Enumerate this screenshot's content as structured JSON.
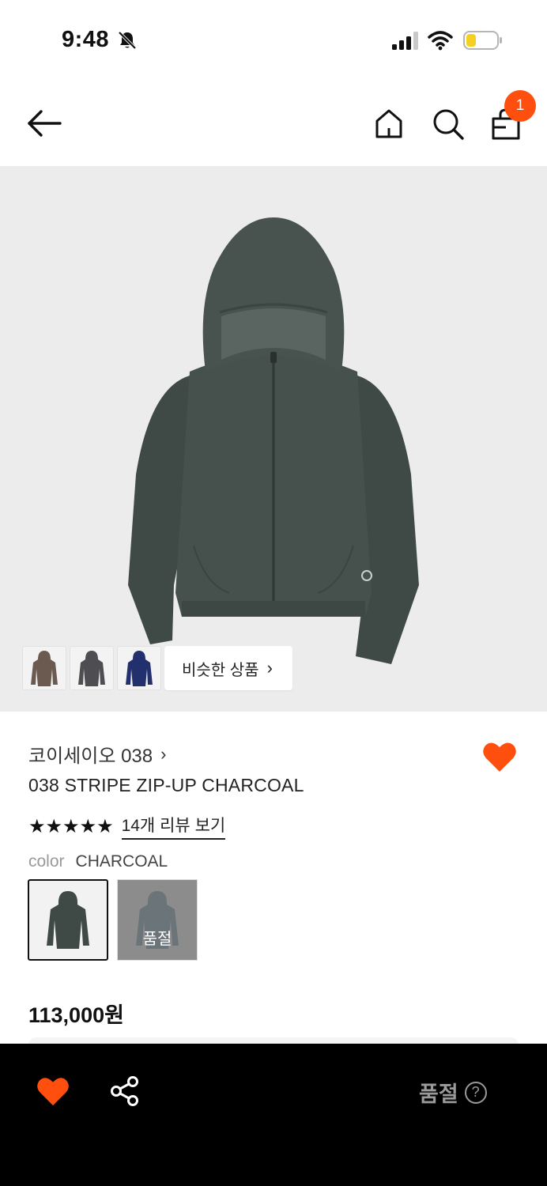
{
  "status_bar": {
    "time": "9:48"
  },
  "nav": {
    "cart_count": "1"
  },
  "gallery": {
    "similar_label": "비슷한 상품",
    "similar_chevron": "›"
  },
  "product": {
    "brand": "코이세이오 038",
    "brand_chevron": "›",
    "name": "038 STRIPE ZIP-UP CHARCOAL",
    "stars": "★★★★★",
    "rating_stars": 5,
    "review_link": "14개 리뷰 보기",
    "color_label": "color",
    "color_value": "CHARCOAL",
    "swatch_soldout": "품절",
    "price": "113,000원",
    "liked": true
  },
  "bottom_bar": {
    "soldout_label": "품절",
    "help": "?"
  },
  "colors": {
    "accent": "#ff4f0f",
    "bottom_bar_bg": "#000000",
    "image_bg": "#ececec"
  }
}
